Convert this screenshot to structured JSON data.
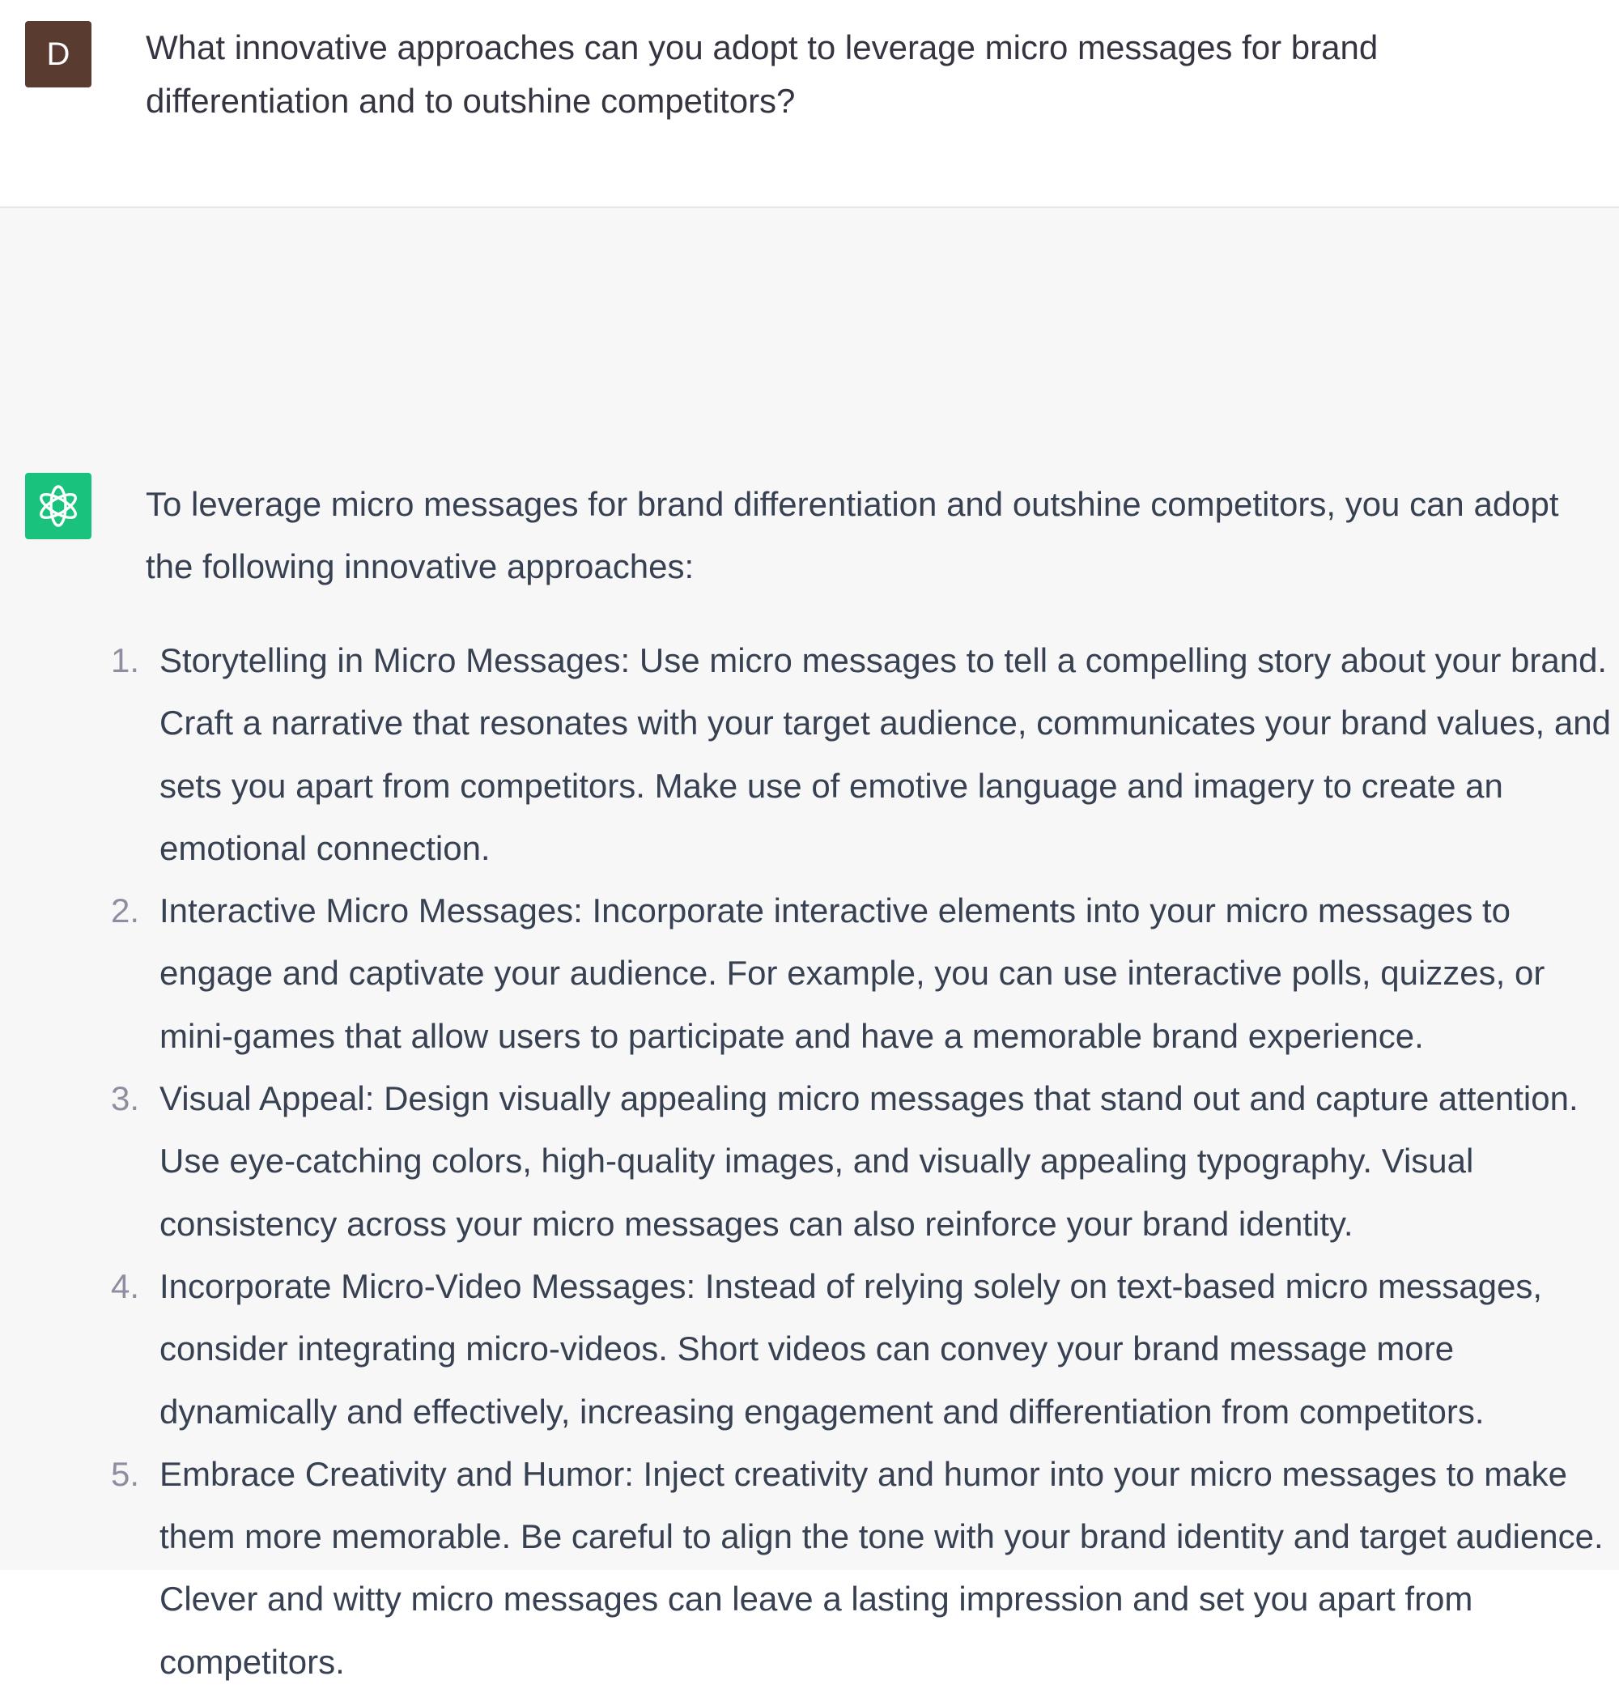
{
  "conversation": {
    "user": {
      "avatar_letter": "D",
      "avatar_color": "#5a3b30",
      "message": "What innovative approaches can you adopt to leverage micro messages for brand differentiation and to outshine competitors?"
    },
    "assistant": {
      "avatar_icon": "openai-logo-icon",
      "avatar_color": "#19c37d",
      "intro": "To leverage micro messages for brand differentiation and outshine competitors, you can adopt the following innovative approaches:",
      "items": [
        {
          "number": "1.",
          "text": "Storytelling in Micro Messages: Use micro messages to tell a compelling story about your brand. Craft a narrative that resonates with your target audience, communicates your brand values, and sets you apart from competitors. Make use of emotive language and imagery to create an emotional connection."
        },
        {
          "number": "2.",
          "text": "Interactive Micro Messages: Incorporate interactive elements into your micro messages to engage and captivate your audience. For example, you can use interactive polls, quizzes, or mini-games that allow users to participate and have a memorable brand experience."
        },
        {
          "number": "3.",
          "text": "Visual Appeal: Design visually appealing micro messages that stand out and capture attention. Use eye-catching colors, high-quality images, and visually appealing typography. Visual consistency across your micro messages can also reinforce your brand identity."
        },
        {
          "number": "4.",
          "text": "Incorporate Micro-Video Messages: Instead of relying solely on text-based micro messages, consider integrating micro-videos. Short videos can convey your brand message more dynamically and effectively, increasing engagement and differentiation from competitors."
        },
        {
          "number": "5.",
          "text": "Embrace Creativity and Humor: Inject creativity and humor into your micro messages to make them more memorable. Be careful to align the tone with your brand identity and target audience. Clever and witty micro messages can leave a lasting impression and set you apart from competitors."
        }
      ]
    }
  }
}
